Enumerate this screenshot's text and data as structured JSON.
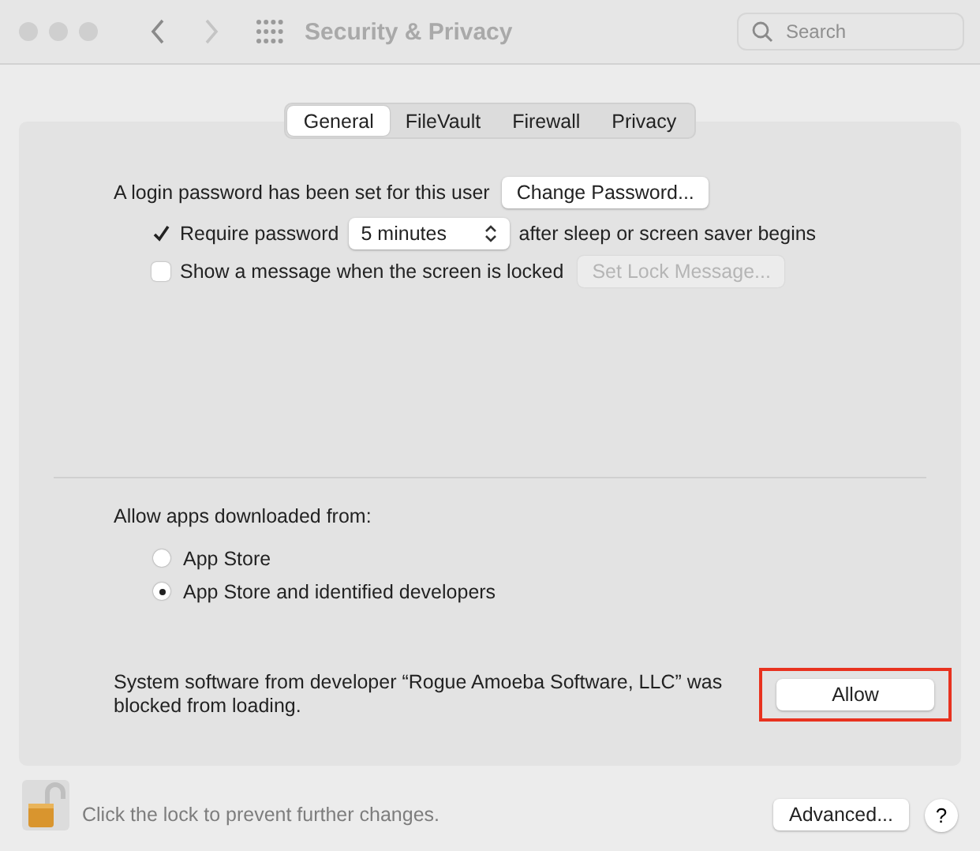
{
  "window": {
    "title": "Security & Privacy",
    "search": {
      "placeholder": "Search"
    }
  },
  "tabs": [
    {
      "label": "General",
      "selected": true
    },
    {
      "label": "FileVault",
      "selected": false
    },
    {
      "label": "Firewall",
      "selected": false
    },
    {
      "label": "Privacy",
      "selected": false
    }
  ],
  "login": {
    "text": "A login password has been set for this user",
    "button": "Change Password..."
  },
  "require_password": {
    "checked": true,
    "label": "Require password",
    "delay": "5 minutes",
    "suffix": "after sleep or screen saver begins"
  },
  "lock_message": {
    "checked": false,
    "label": "Show a message when the screen is locked",
    "button": "Set Lock Message...",
    "button_disabled": true
  },
  "allow_apps": {
    "label": "Allow apps downloaded from:",
    "options": [
      {
        "label": "App Store",
        "selected": false
      },
      {
        "label": "App Store and identified developers",
        "selected": true
      }
    ]
  },
  "blocked": {
    "text": "System software from developer “Rogue Amoeba Software, LLC” was blocked from loading.",
    "button": "Allow",
    "highlighted": true
  },
  "footer": {
    "lock_text": "Click the lock to prevent further changes.",
    "advanced": "Advanced...",
    "help": "?"
  }
}
